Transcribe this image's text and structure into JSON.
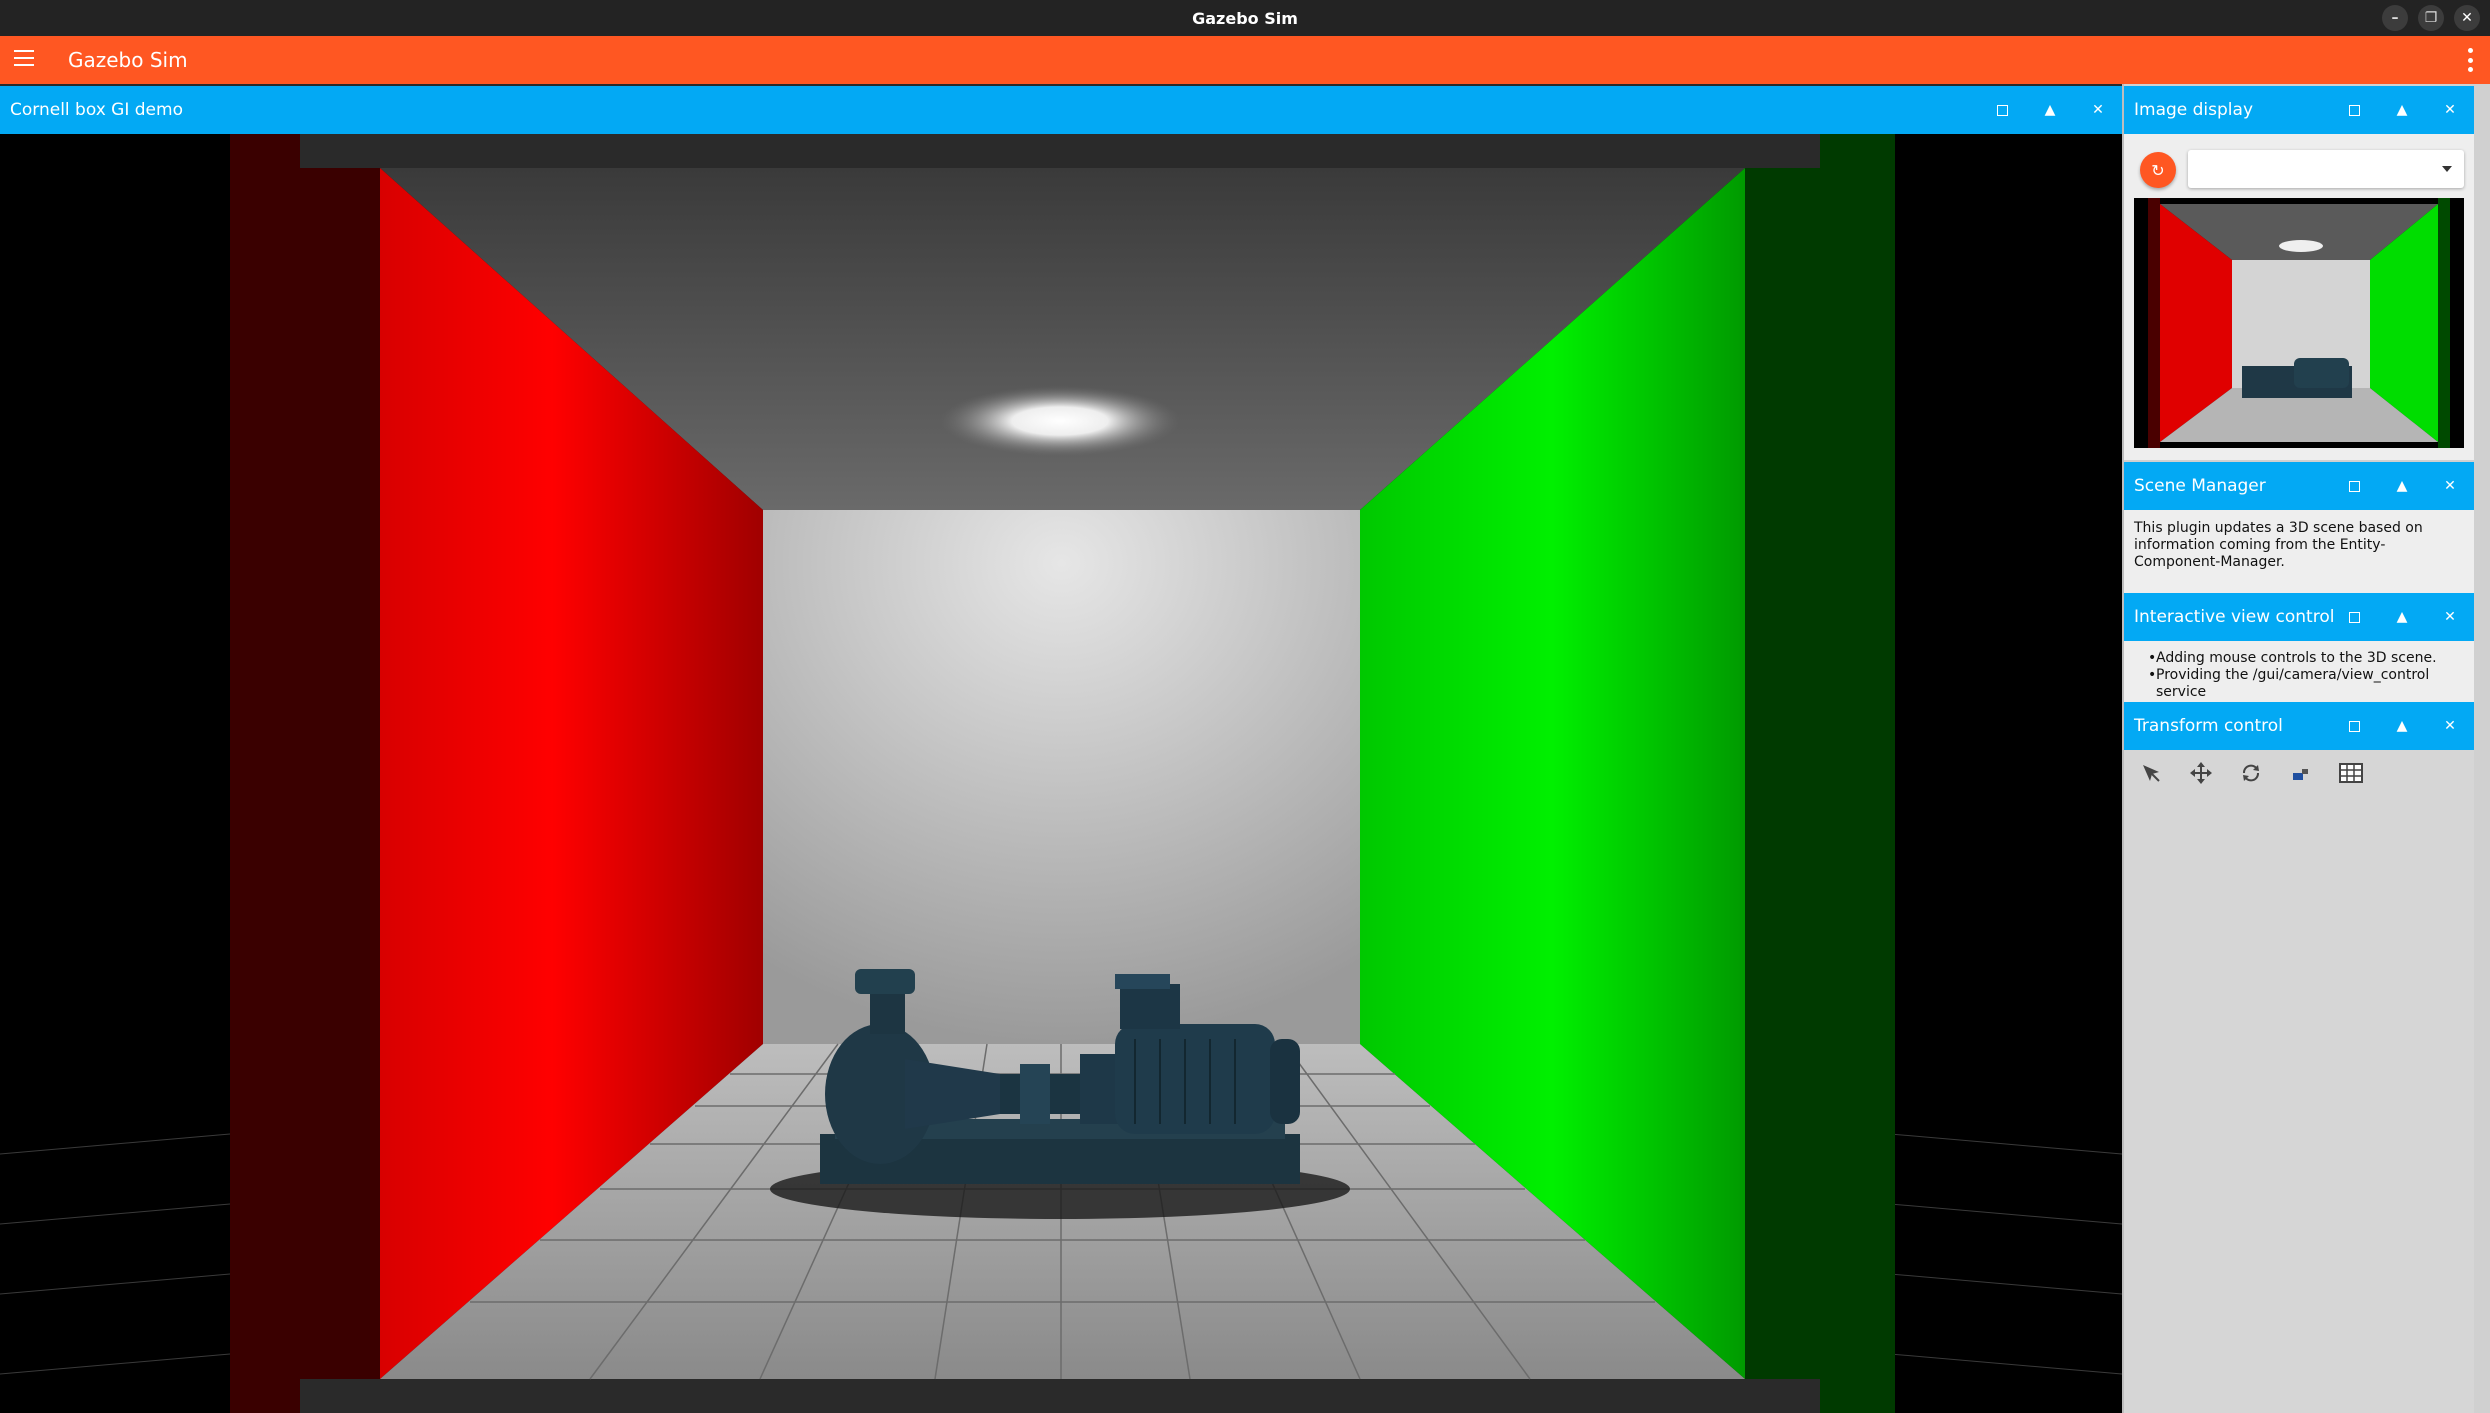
{
  "os": {
    "window_title": "Gazebo Sim",
    "min_label": "–",
    "restore_label": "❐",
    "close_label": "✕"
  },
  "appbar": {
    "title": "Gazebo Sim",
    "color": "#ff5722"
  },
  "scene_panel": {
    "title": "Cornell box GI demo"
  },
  "panel_buttons": {
    "float": "",
    "collapse": "▲",
    "close": "✕"
  },
  "image_display": {
    "title": "Image display",
    "refresh_icon": "↻",
    "selected_topic": ""
  },
  "scene_manager": {
    "title": "Scene Manager",
    "description": "This plugin updates a 3D scene based on information coming from the Entity-Component-Manager."
  },
  "view_control": {
    "title": "Interactive view control",
    "bullets": [
      "Adding mouse controls to the 3D scene.",
      "Providing the /gui/camera/view_control service"
    ]
  },
  "transform_control": {
    "title": "Transform control",
    "tools": [
      "select-icon",
      "translate-icon",
      "rotate-icon",
      "snap-icon",
      "grid-icon"
    ]
  },
  "colors": {
    "header_blue": "#03a9f4",
    "accent_orange": "#ff5722",
    "wall_red": "#e00000",
    "wall_green": "#00dd00"
  }
}
